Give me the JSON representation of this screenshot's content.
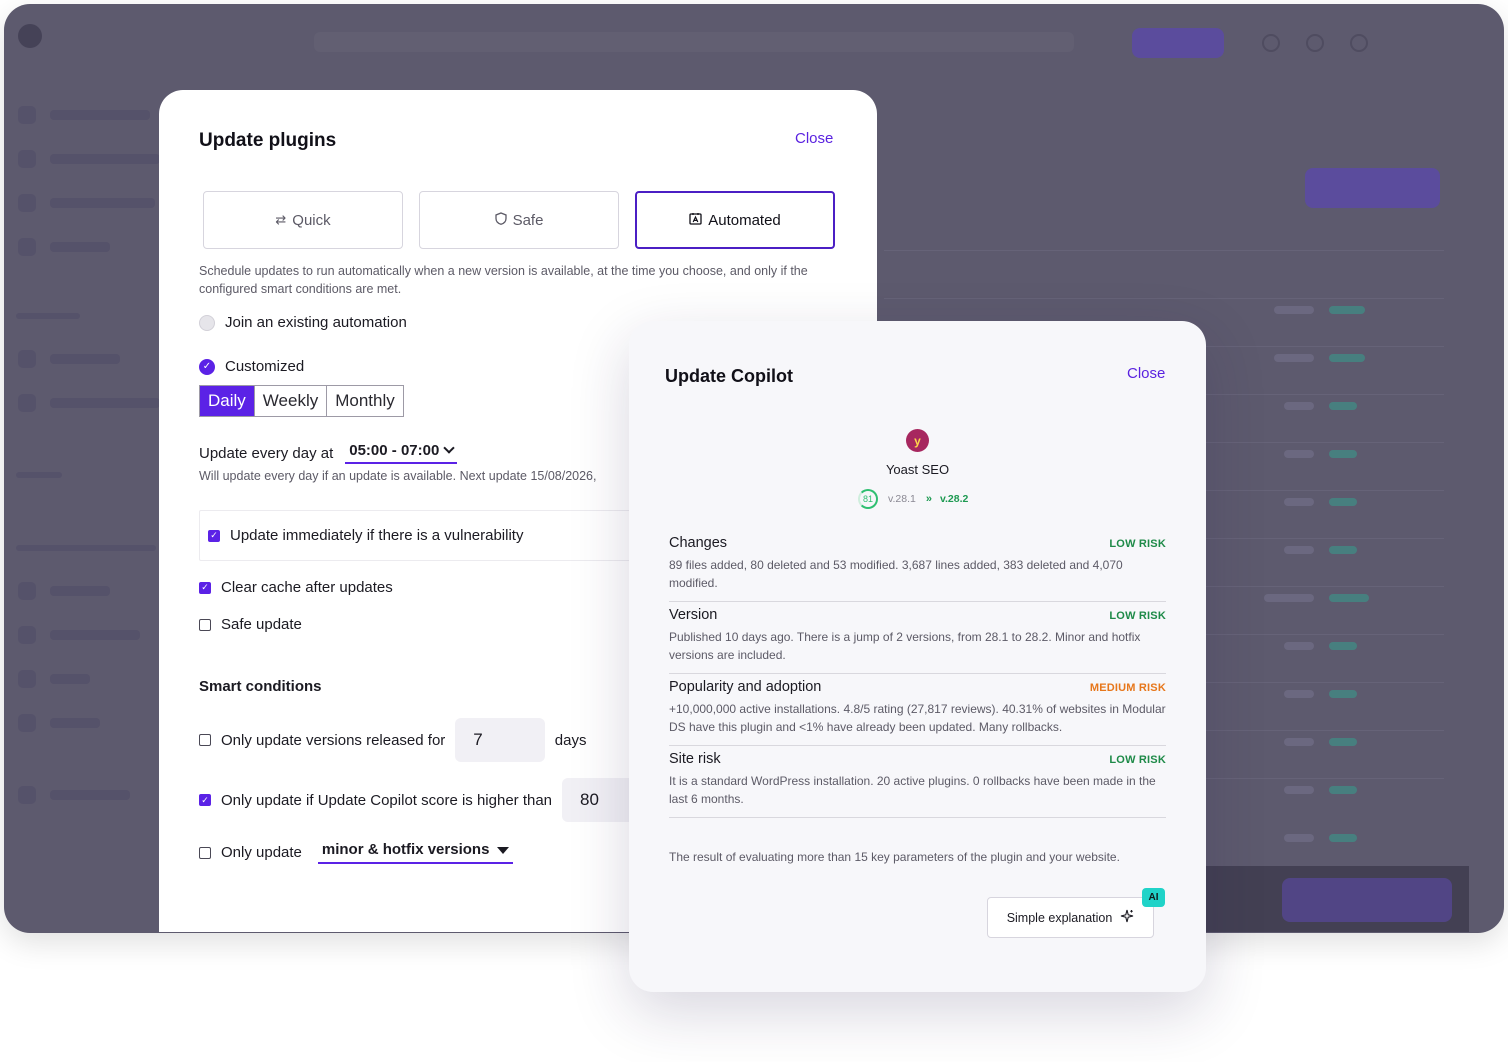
{
  "colors": {
    "accent": "#5b22e6",
    "low_risk": "#1e8a48",
    "medium_risk": "#e7771b",
    "score": "#2fbf71",
    "ai_badge": "#20d3c8"
  },
  "plugins_dialog": {
    "title": "Update plugins",
    "close_label": "Close",
    "modes": [
      {
        "label": "Quick",
        "icon": "swap-icon",
        "active": false
      },
      {
        "label": "Safe",
        "icon": "shield-icon",
        "active": false
      },
      {
        "label": "Automated",
        "icon": "auto-calendar-icon",
        "active": true
      }
    ],
    "description": "Schedule updates to run automatically when a new version is available, at the time you choose, and only if the configured smart conditions are met.",
    "join_label": "Join an existing automation",
    "customized_label": "Customized",
    "frequency": {
      "options": [
        "Daily",
        "Weekly",
        "Monthly"
      ],
      "selected": "Daily"
    },
    "update_every_label": "Update every day at",
    "time_window": "05:00 - 07:00",
    "next_update_note": "Will update every day if an update is available. Next update 15/08/2026,",
    "vulnerability_label": "Update immediately if there is a vulnerability",
    "vulnerability_checked": true,
    "clear_cache_label": "Clear cache after updates",
    "clear_cache_checked": true,
    "safe_update_label": "Safe update",
    "safe_update_checked": false,
    "smart_conditions": {
      "title": "Smart conditions",
      "released_label": "Only update versions released for",
      "released_value": "7",
      "released_unit": "days",
      "released_checked": false,
      "score_label": "Only update if Update Copilot score is higher than",
      "score_value": "80",
      "score_checked": true,
      "versions_label": "Only update",
      "versions_value": "minor & hotfix versions",
      "versions_checked": false
    }
  },
  "copilot_dialog": {
    "title": "Update Copilot",
    "close_label": "Close",
    "plugin": {
      "name": "Yoast SEO",
      "score": "81",
      "version_from": "v.28.1",
      "version_to": "v.28.2",
      "icon": "yoast-logo-icon"
    },
    "risks": [
      {
        "title": "Changes",
        "level": "LOW RISK",
        "severity": "low",
        "detail": "89 files added, 80 deleted and 53 modified. 3,687 lines added, 383 deleted and 4,070 modified."
      },
      {
        "title": "Version",
        "level": "LOW RISK",
        "severity": "low",
        "detail": "Published 10 days ago. There is a jump of 2 versions, from 28.1 to 28.2. Minor and hotfix versions are included."
      },
      {
        "title": "Popularity and adoption",
        "level": "MEDIUM RISK",
        "severity": "medium",
        "detail": "+10,000,000 active installations. 4.8/5 rating (27,817 reviews). 40.31% of websites in Modular DS have this plugin and <1% have already been updated. Many rollbacks."
      },
      {
        "title": "Site risk",
        "level": "LOW RISK",
        "severity": "low",
        "detail": "It is a standard WordPress installation. 20 active plugins. 0 rollbacks have been made in the last 6 months."
      }
    ],
    "footer_note": "The result of evaluating more than 15 key parameters of the plugin and your website.",
    "simple_explanation_label": "Simple explanation",
    "ai_badge": "AI"
  }
}
